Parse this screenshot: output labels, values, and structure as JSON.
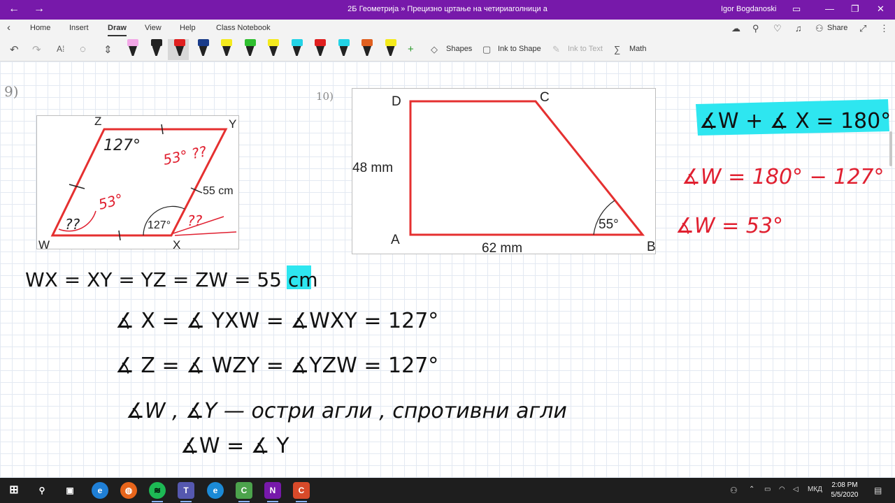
{
  "window": {
    "title": "2Б Геометрија » Прецизно цртање на четириаголници а",
    "user": "Igor Bogdanoski"
  },
  "menu": {
    "tabs": [
      "Home",
      "Insert",
      "Draw",
      "View",
      "Help",
      "Class Notebook"
    ],
    "active_tab": "Draw",
    "share_label": "Share"
  },
  "ribbon": {
    "shapes_label": "Shapes",
    "ink_to_shape_label": "Ink to Shape",
    "ink_to_text_label": "Ink to Text",
    "math_label": "Math",
    "pens": [
      {
        "color": "#f2a7e6"
      },
      {
        "color": "#222222"
      },
      {
        "color": "#e02020"
      },
      {
        "color": "#1a3c8a"
      },
      {
        "color": "#f4ea1c"
      },
      {
        "color": "#2fbf2f"
      },
      {
        "color": "#f4ea1c"
      },
      {
        "color": "#22d3e6"
      },
      {
        "color": "#e02020"
      },
      {
        "color": "#22d3e6"
      },
      {
        "color": "#e06020"
      },
      {
        "color": "#f4ea1c"
      }
    ]
  },
  "figure9": {
    "problem_number": "9)",
    "vertex_z": "Z",
    "vertex_y": "Y",
    "vertex_w": "W",
    "vertex_x": "X",
    "side_label": "55 cm",
    "angle_x": "127°"
  },
  "figure10": {
    "problem_number": "10)",
    "vertex_d": "D",
    "vertex_c": "C",
    "vertex_a": "A",
    "vertex_b": "B",
    "side_ad": "48 mm",
    "side_ab": "62 mm",
    "angle_b": "55°"
  },
  "ink": {
    "annot_z": "127°",
    "annot_y": "53° ??",
    "annot_w_mid": "53°",
    "annot_w": "??",
    "annot_x": "??",
    "line1": "WX = XY = YZ = ZW = 55 cm",
    "line2": "∡ X = ∡ YXW = ∡WXY = 127°",
    "line3": "∡ Z = ∡ WZY = ∡YZW = 127°",
    "line4": "∡W , ∡Y — остри агли , спротивни агли",
    "line5": "∡W = ∡ Y",
    "right1": "∡W + ∡ X = 180°",
    "right2": "∡W = 180° − 127°",
    "right3": "∡W = 53°"
  },
  "taskbar": {
    "lang": "МКД",
    "time": "2:08 PM",
    "date": "5/5/2020",
    "apps": [
      "search",
      "task-view",
      "edge",
      "firefox",
      "spotify",
      "teams",
      "ie",
      "camtasia",
      "onenote",
      "camtasia-recorder"
    ]
  },
  "colors": {
    "accent": "#7719aa",
    "ink_red": "#e02030",
    "figure_red": "#e53030",
    "highlight": "#2ee6f0"
  }
}
